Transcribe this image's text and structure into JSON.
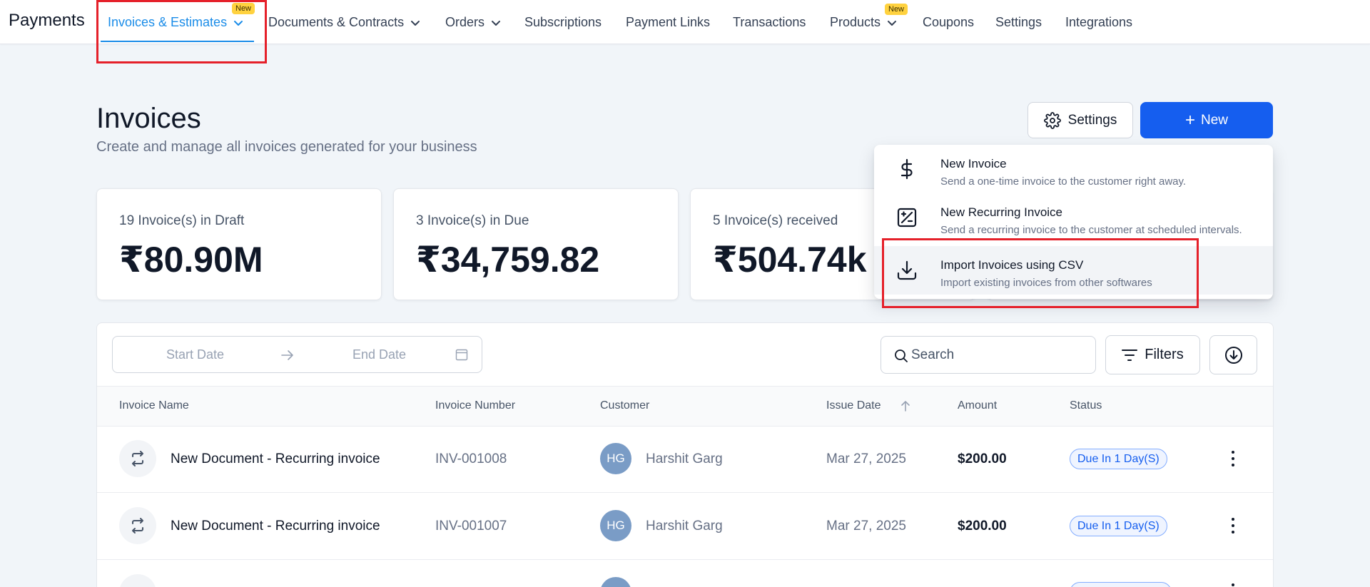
{
  "nav": {
    "brand": "Payments",
    "items": [
      {
        "label": "Invoices & Estimates",
        "badge": "New"
      },
      {
        "label": "Documents & Contracts"
      },
      {
        "label": "Orders"
      },
      {
        "label": "Subscriptions"
      },
      {
        "label": "Payment Links"
      },
      {
        "label": "Transactions"
      },
      {
        "label": "Products",
        "badge": "New"
      },
      {
        "label": "Coupons"
      },
      {
        "label": "Settings"
      },
      {
        "label": "Integrations"
      }
    ]
  },
  "header": {
    "title": "Invoices",
    "subtitle": "Create and manage all invoices generated for your business",
    "settings_label": "Settings",
    "new_label": "New",
    "new_icon": "+"
  },
  "stats": [
    {
      "label": "19 Invoice(s) in Draft",
      "value": "₹80.90M"
    },
    {
      "label": "3 Invoice(s) in Due",
      "value": "₹34,759.82"
    },
    {
      "label": "5 Invoice(s) received",
      "value": "₹504.74k"
    }
  ],
  "dropdown": {
    "items": [
      {
        "title": "New Invoice",
        "desc": "Send a one-time invoice to the customer right away.",
        "icon": "dollar-icon"
      },
      {
        "title": "New Recurring Invoice",
        "desc": "Send a recurring invoice to the customer at scheduled intervals.",
        "icon": "recurring-invoice-icon"
      },
      {
        "title": "Import Invoices using CSV",
        "desc": "Import existing invoices from other softwares",
        "icon": "download-icon"
      }
    ]
  },
  "filters": {
    "start_date": "Start Date",
    "end_date": "End Date",
    "search_placeholder": "Search",
    "filters_label": "Filters"
  },
  "table": {
    "columns": [
      "Invoice Name",
      "Invoice Number",
      "Customer",
      "Issue Date",
      "Amount",
      "Status"
    ],
    "rows": [
      {
        "name": "New Document - Recurring invoice",
        "number": "INV-001008",
        "initials": "HG",
        "customer": "Harshit Garg",
        "date": "Mar 27, 2025",
        "amount": "$200.00",
        "status": "Due In 1 Day(S)"
      },
      {
        "name": "New Document - Recurring invoice",
        "number": "INV-001007",
        "initials": "HG",
        "customer": "Harshit Garg",
        "date": "Mar 27, 2025",
        "amount": "$200.00",
        "status": "Due In 1 Day(S)"
      }
    ]
  },
  "colors": {
    "accent": "#155eef",
    "nav_active": "#1a8ce8",
    "badge": "#ffd23f",
    "annotation": "#e5202a"
  }
}
